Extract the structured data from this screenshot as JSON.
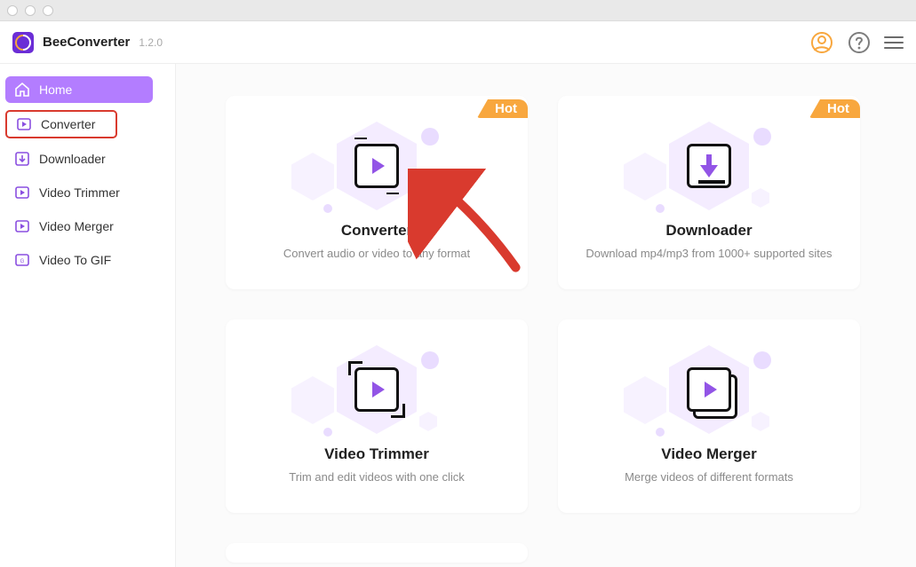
{
  "app": {
    "name": "BeeConverter",
    "version": "1.2.0"
  },
  "sidebar": {
    "items": [
      {
        "label": "Home",
        "icon": "home-icon",
        "active": true,
        "highlight": false
      },
      {
        "label": "Converter",
        "icon": "converter-icon",
        "active": false,
        "highlight": true
      },
      {
        "label": "Downloader",
        "icon": "downloader-icon",
        "active": false,
        "highlight": false
      },
      {
        "label": "Video Trimmer",
        "icon": "video-trimmer-icon",
        "active": false,
        "highlight": false
      },
      {
        "label": "Video Merger",
        "icon": "video-merger-icon",
        "active": false,
        "highlight": false
      },
      {
        "label": "Video To GIF",
        "icon": "video-to-gif-icon",
        "active": false,
        "highlight": false
      }
    ]
  },
  "badges": {
    "hot": "Hot"
  },
  "cards": [
    {
      "id": "converter",
      "title": "Converter",
      "description": "Convert audio or video to any format",
      "hot": true,
      "icon": "converter-card-icon"
    },
    {
      "id": "downloader",
      "title": "Downloader",
      "description": "Download mp4/mp3 from 1000+ supported sites",
      "hot": true,
      "icon": "downloader-card-icon"
    },
    {
      "id": "video-trimmer",
      "title": "Video Trimmer",
      "description": "Trim and edit videos with one click",
      "hot": false,
      "icon": "trimmer-card-icon"
    },
    {
      "id": "video-merger",
      "title": "Video Merger",
      "description": "Merge videos of different formats",
      "hot": false,
      "icon": "merger-card-icon"
    }
  ],
  "colors": {
    "accent": "#b37dff",
    "hot": "#f8a73e",
    "annotation": "#d93a2e"
  },
  "header_icons": {
    "account": "account-icon",
    "help": "help-icon",
    "menu": "menu-icon"
  }
}
